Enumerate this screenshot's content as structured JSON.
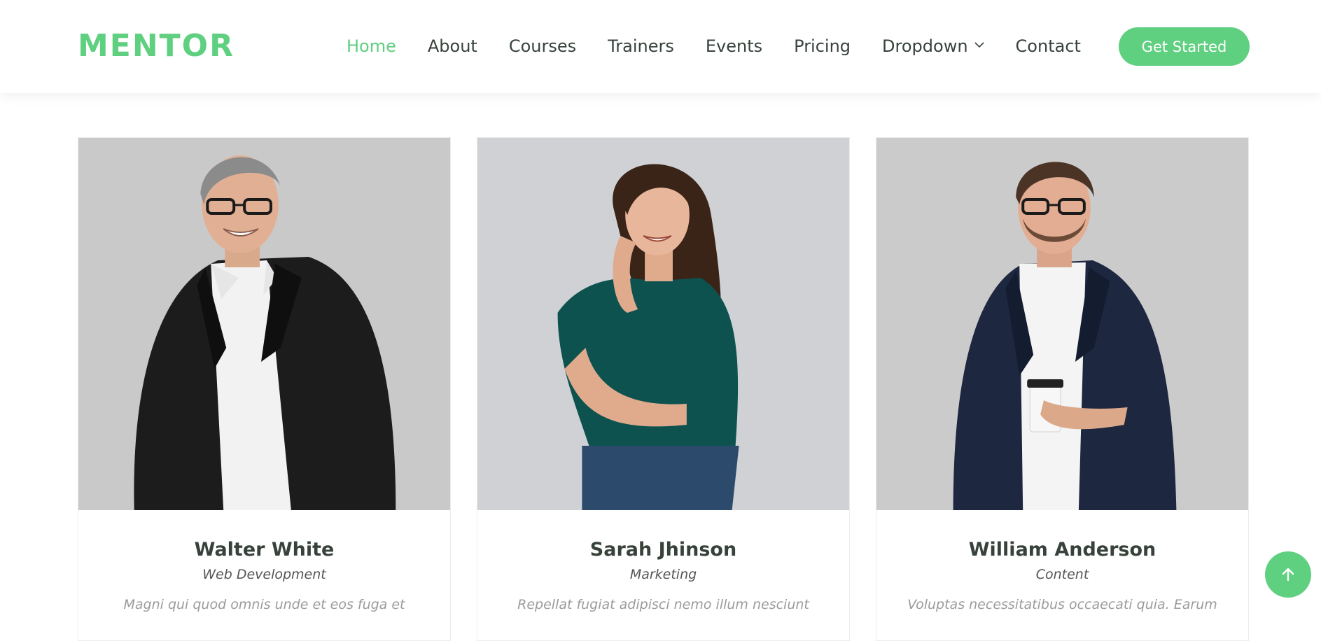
{
  "colors": {
    "accent": "#5fcf80",
    "text_dark": "#37423b",
    "photo_bg_1": "#c9c9ca",
    "photo_bg_2": "#d0d1d4",
    "photo_bg_3": "#cbcbcc"
  },
  "header": {
    "logo": "MENTOR",
    "nav": [
      {
        "label": "Home",
        "active": true
      },
      {
        "label": "About",
        "active": false
      },
      {
        "label": "Courses",
        "active": false
      },
      {
        "label": "Trainers",
        "active": false
      },
      {
        "label": "Events",
        "active": false
      },
      {
        "label": "Pricing",
        "active": false
      },
      {
        "label": "Dropdown",
        "active": false,
        "icon": "chevron-down-icon"
      },
      {
        "label": "Contact",
        "active": false
      }
    ],
    "cta": "Get Started"
  },
  "trainers": [
    {
      "name": "Walter White",
      "role": "Web Development",
      "bio": "Magni qui quod omnis unde et eos fuga et"
    },
    {
      "name": "Sarah Jhinson",
      "role": "Marketing",
      "bio": "Repellat fugiat adipisci nemo illum nesciunt"
    },
    {
      "name": "William Anderson",
      "role": "Content",
      "bio": "Voluptas necessitatibus occaecati quia. Earum"
    }
  ],
  "back_to_top": {
    "icon": "arrow-up-icon"
  }
}
